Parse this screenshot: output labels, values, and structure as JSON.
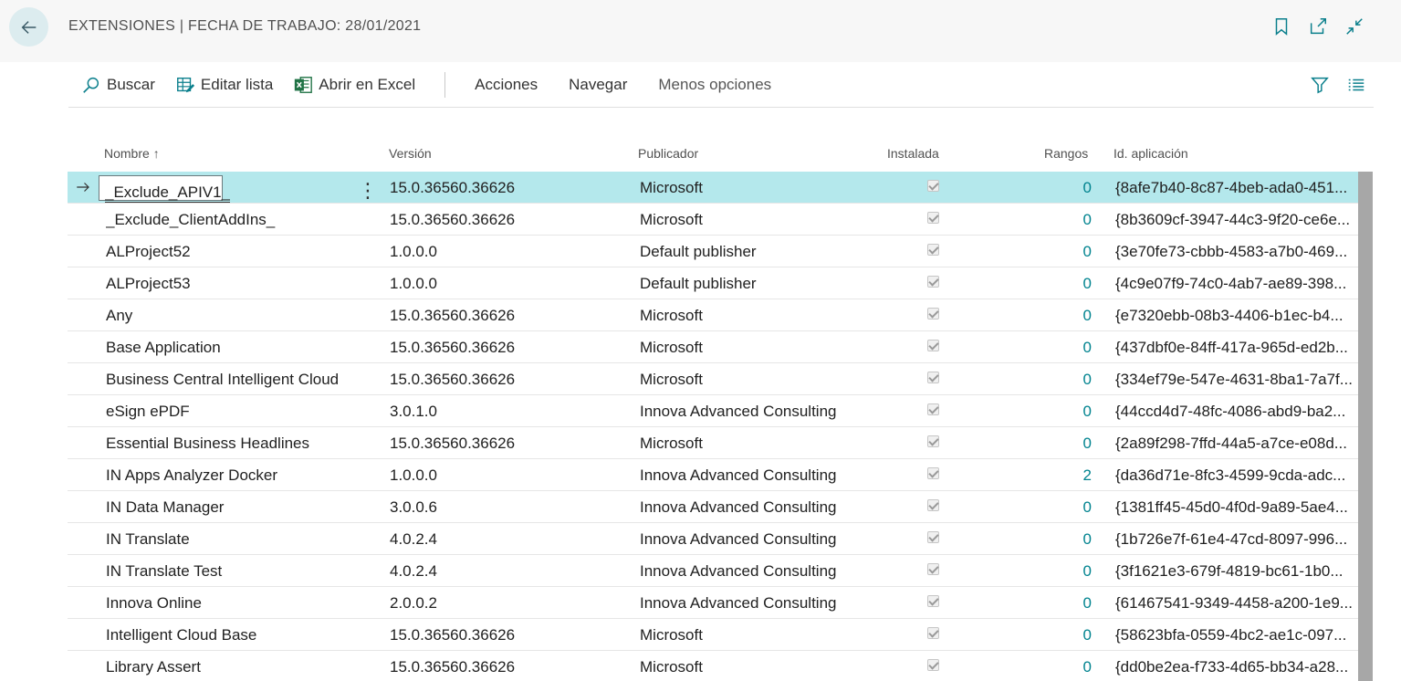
{
  "header": {
    "title": "EXTENSIONES | FECHA DE TRABAJO: 28/01/2021"
  },
  "toolbar": {
    "search_label": "Buscar",
    "edit_list_label": "Editar lista",
    "excel_label": "Abrir en Excel",
    "actions_label": "Acciones",
    "navigate_label": "Navegar",
    "less_options_label": "Menos opciones"
  },
  "columns": {
    "name": "Nombre",
    "name_sort": "↑",
    "version": "Versión",
    "publisher": "Publicador",
    "installed": "Instalada",
    "ranges": "Rangos",
    "app_id": "Id. aplicación"
  },
  "rows": [
    {
      "name": "_Exclude_APIV1_",
      "version": "15.0.36560.36626",
      "publisher": "Microsoft",
      "installed": true,
      "ranges": "0",
      "app_id": "{8afe7b40-8c87-4beb-ada0-451..."
    },
    {
      "name": "_Exclude_ClientAddIns_",
      "version": "15.0.36560.36626",
      "publisher": "Microsoft",
      "installed": true,
      "ranges": "0",
      "app_id": "{8b3609cf-3947-44c3-9f20-ce6e..."
    },
    {
      "name": "ALProject52",
      "version": "1.0.0.0",
      "publisher": "Default publisher",
      "installed": true,
      "ranges": "0",
      "app_id": "{3e70fe73-cbbb-4583-a7b0-469..."
    },
    {
      "name": "ALProject53",
      "version": "1.0.0.0",
      "publisher": "Default publisher",
      "installed": true,
      "ranges": "0",
      "app_id": "{4c9e07f9-74c0-4ab7-ae89-398..."
    },
    {
      "name": "Any",
      "version": "15.0.36560.36626",
      "publisher": "Microsoft",
      "installed": true,
      "ranges": "0",
      "app_id": "{e7320ebb-08b3-4406-b1ec-b4..."
    },
    {
      "name": "Base Application",
      "version": "15.0.36560.36626",
      "publisher": "Microsoft",
      "installed": true,
      "ranges": "0",
      "app_id": "{437dbf0e-84ff-417a-965d-ed2b..."
    },
    {
      "name": "Business Central Intelligent Cloud",
      "version": "15.0.36560.36626",
      "publisher": "Microsoft",
      "installed": true,
      "ranges": "0",
      "app_id": "{334ef79e-547e-4631-8ba1-7a7f..."
    },
    {
      "name": "eSign ePDF",
      "version": "3.0.1.0",
      "publisher": "Innova Advanced Consulting",
      "installed": true,
      "ranges": "0",
      "app_id": "{44ccd4d7-48fc-4086-abd9-ba2..."
    },
    {
      "name": "Essential Business Headlines",
      "version": "15.0.36560.36626",
      "publisher": "Microsoft",
      "installed": true,
      "ranges": "0",
      "app_id": "{2a89f298-7ffd-44a5-a7ce-e08d..."
    },
    {
      "name": "IN Apps Analyzer Docker",
      "version": "1.0.0.0",
      "publisher": "Innova Advanced Consulting",
      "installed": true,
      "ranges": "2",
      "app_id": "{da36d71e-8fc3-4599-9cda-adc..."
    },
    {
      "name": "IN Data Manager",
      "version": "3.0.0.6",
      "publisher": "Innova Advanced Consulting",
      "installed": true,
      "ranges": "0",
      "app_id": "{1381ff45-45d0-4f0d-9a89-5ae4..."
    },
    {
      "name": "IN Translate",
      "version": "4.0.2.4",
      "publisher": "Innova Advanced Consulting",
      "installed": true,
      "ranges": "0",
      "app_id": "{1b726e7f-61e4-47cd-8097-996..."
    },
    {
      "name": "IN Translate Test",
      "version": "4.0.2.4",
      "publisher": "Innova Advanced Consulting",
      "installed": true,
      "ranges": "0",
      "app_id": "{3f1621e3-679f-4819-bc61-1b0..."
    },
    {
      "name": "Innova Online",
      "version": "2.0.0.2",
      "publisher": "Innova Advanced Consulting",
      "installed": true,
      "ranges": "0",
      "app_id": "{61467541-9349-4458-a200-1e9..."
    },
    {
      "name": "Intelligent Cloud Base",
      "version": "15.0.36560.36626",
      "publisher": "Microsoft",
      "installed": true,
      "ranges": "0",
      "app_id": "{58623bfa-0559-4bc2-ae1c-097..."
    },
    {
      "name": "Library Assert",
      "version": "15.0.36560.36626",
      "publisher": "Microsoft",
      "installed": true,
      "ranges": "0",
      "app_id": "{dd0be2ea-f733-4d65-bb34-a28..."
    }
  ],
  "colors": {
    "selected_row": "#b4e8ec",
    "link_teal": "#00838f",
    "back_button_bg": "#dcecef"
  }
}
